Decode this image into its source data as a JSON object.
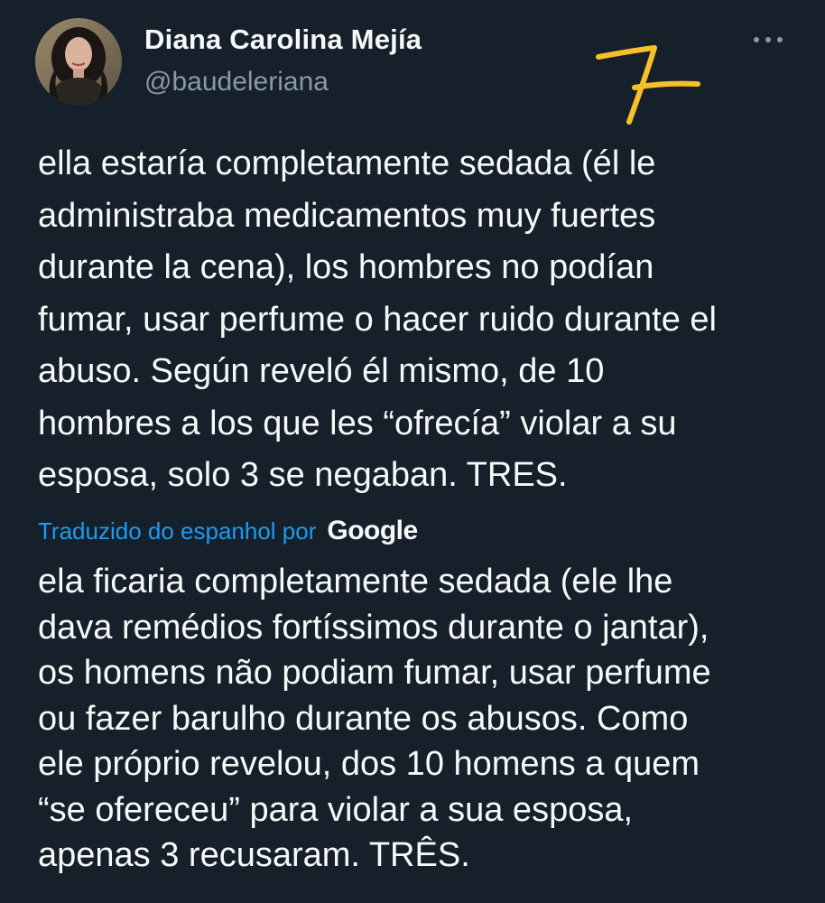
{
  "author": {
    "display_name": "Diana Carolina Mejía",
    "handle": "@baudeleriana",
    "avatar_icon": "profile-photo"
  },
  "more_icon": "more-options-icon",
  "annotation_mark": "handwritten-7",
  "tweet": {
    "original_text": "ella estaría completamente sedada (él le\nadministraba medicamentos muy fuertes\ndurante la cena), los hombres no podían\nfumar, usar perfume o hacer ruido durante el\nabuso. Según reveló él mismo, de 10\nhombres a los que les “ofrecía” violar a su\nesposa, solo 3 se negaban. TRES.",
    "translated_by_label": "Traduzido do espanhol por",
    "translator_logo": "Google",
    "translated_text": "ela ficaria completamente sedada (ele lhe\ndava remédios fortíssimos durante o jantar),\nos homens não podiam fumar, usar perfume\nou fazer barulho durante os abusos. Como\nele próprio revelou, dos 10 homens a quem\n“se ofereceu” para violar a sua esposa,\napenas 3 recusaram. TRÊS."
  },
  "colors": {
    "background": "#15202b",
    "text_primary": "#f7f9f9",
    "text_secondary": "#8b98a5",
    "link": "#1d9bf0",
    "annotation": "#f6c02a"
  }
}
